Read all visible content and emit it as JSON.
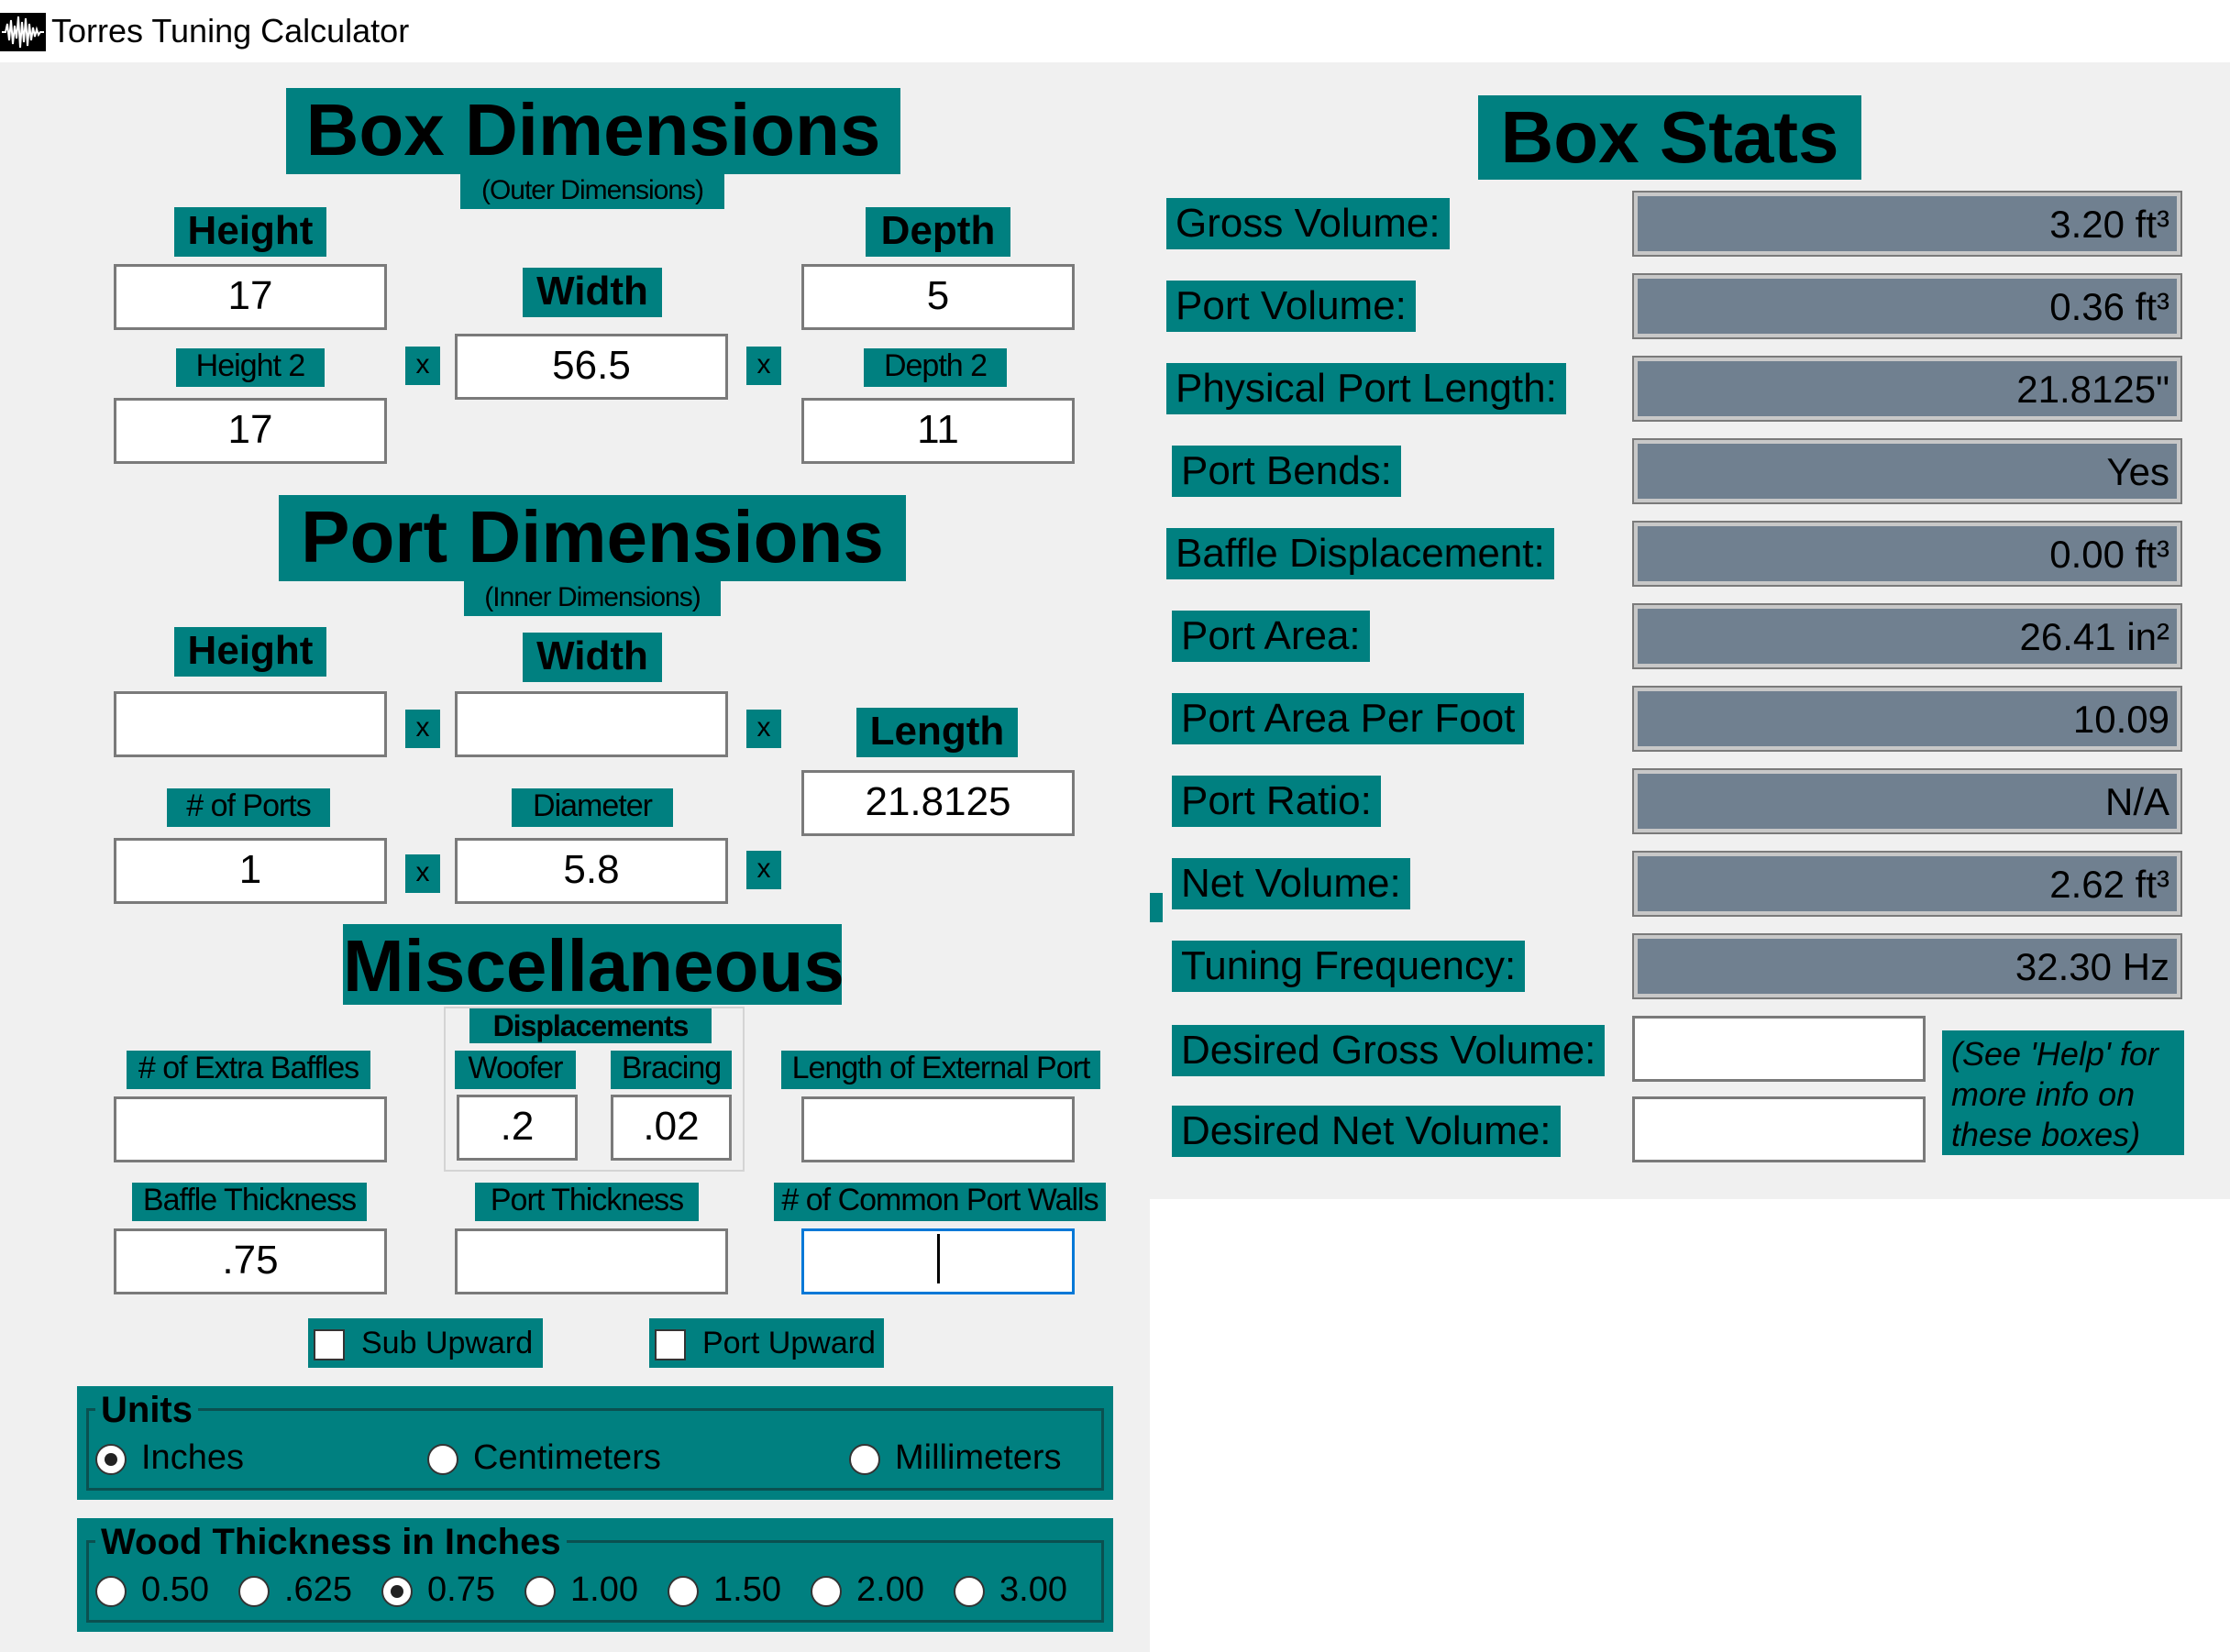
{
  "window": {
    "title": "Torres Tuning Calculator"
  },
  "box_dimensions": {
    "title": "Box Dimensions",
    "subtitle": "(Outer Dimensions)",
    "height_label": "Height",
    "height_value": "17",
    "height2_label": "Height 2",
    "height2_value": "17",
    "width_label": "Width",
    "width_value": "56.5",
    "depth_label": "Depth",
    "depth_value": "5",
    "depth2_label": "Depth 2",
    "depth2_value": "11",
    "times": "x"
  },
  "port_dimensions": {
    "title": "Port Dimensions",
    "subtitle": "(Inner Dimensions)",
    "height_label": "Height",
    "height_value": "",
    "width_label": "Width",
    "width_value": "",
    "length_label": "Length",
    "length_value": "21.8125",
    "ports_label": "# of Ports",
    "ports_value": "1",
    "diameter_label": "Diameter",
    "diameter_value": "5.8",
    "times": "x"
  },
  "misc": {
    "title": "Miscellaneous",
    "displacements_label": "Displacements",
    "woofer_label": "Woofer",
    "woofer_value": ".2",
    "bracing_label": "Bracing",
    "bracing_value": ".02",
    "extra_baffles_label": "# of Extra Baffles",
    "extra_baffles_value": "",
    "external_port_label": "Length of External Port",
    "external_port_value": "",
    "baffle_thickness_label": "Baffle Thickness",
    "baffle_thickness_value": ".75",
    "port_thickness_label": "Port Thickness",
    "port_thickness_value": "",
    "common_walls_label": "# of Common Port Walls",
    "common_walls_value": "",
    "sub_upward_label": "Sub Upward",
    "port_upward_label": "Port Upward"
  },
  "units": {
    "title": "Units",
    "options": [
      "Inches",
      "Centimeters",
      "Millimeters"
    ],
    "selected": "Inches"
  },
  "wood": {
    "title": "Wood Thickness in Inches",
    "options": [
      "0.50",
      ".625",
      "0.75",
      "1.00",
      "1.50",
      "2.00",
      "3.00"
    ],
    "selected": "0.75"
  },
  "box_stats": {
    "title": "Box Stats",
    "rows": [
      {
        "label": "Gross Volume:",
        "value": "3.20 ft³"
      },
      {
        "label": "Port Volume:",
        "value": "0.36 ft³"
      },
      {
        "label": "Physical Port Length:",
        "value": "21.8125\""
      },
      {
        "label": "Port Bends:",
        "value": "Yes"
      },
      {
        "label": "Baffle Displacement:",
        "value": "0.00 ft³"
      },
      {
        "label": "Port Area:",
        "value": "26.41 in²"
      },
      {
        "label": "Port Area Per Foot",
        "value": "10.09"
      },
      {
        "label": "Port Ratio:",
        "value": "N/A"
      },
      {
        "label": "Net Volume:",
        "value": "2.62 ft³"
      },
      {
        "label": "Tuning Frequency:",
        "value": "32.30 Hz"
      }
    ],
    "desired_gross_label": "Desired Gross Volume:",
    "desired_gross_value": "",
    "desired_net_label": "Desired Net Volume:",
    "desired_net_value": "",
    "help_note": "(See 'Help' for more info on these boxes)"
  }
}
